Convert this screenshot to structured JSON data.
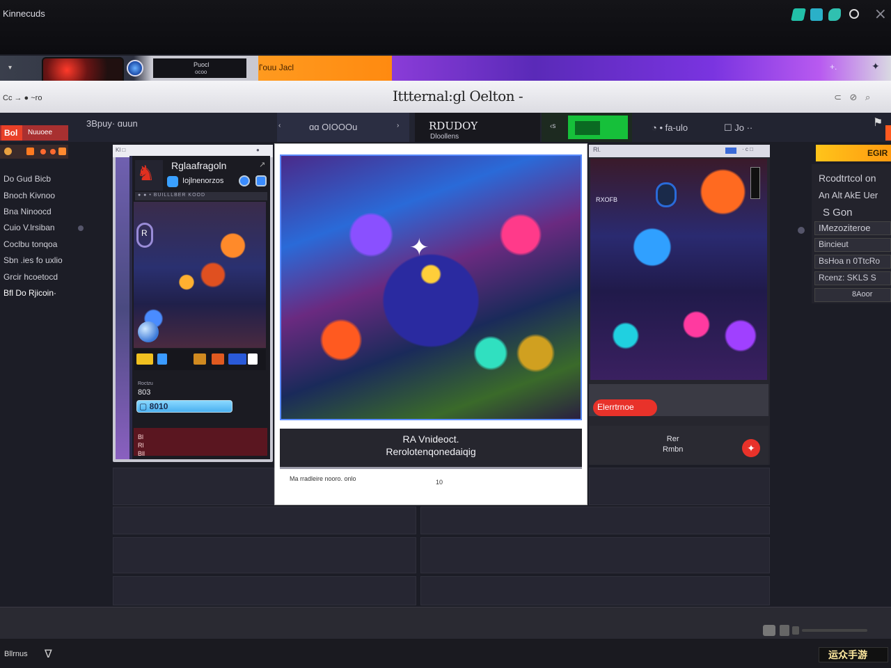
{
  "window": {
    "title": "Kinnecuds",
    "close_glyph": "×"
  },
  "banner": {
    "dark_line1": "Puocl",
    "dark_line2": "ocoo",
    "orange_text": "ſ’ouu Jacl",
    "right_glyph1": "+.",
    "right_glyph2": "✦"
  },
  "toolbar": {
    "left_text": "Cc →  ● ~ro",
    "heading": "Ittternal:gl Oelton -",
    "right_icons": "⊂ ⊘ ⌕"
  },
  "nav": {
    "left_label": "3Bpuy· ɑuun",
    "seg1_label": "ɑɑ OIOOOu",
    "seg2_line1": "RDUDOY",
    "seg2_line2": "Dloollens",
    "seg3_glyph": "‹s",
    "right_label": "◔ • fa-ulo",
    "right_label2": "☐ Jo ··"
  },
  "left_panel": {
    "badge": "Bol",
    "header": "Nuuoее",
    "items": [
      "Do Gud Bicb",
      "Bnoch Kivnoo",
      "Bna Ninoocd",
      "Cuio V.lrsiban",
      "Coclbu tonqoa",
      "Sbn .ies fo uxlio",
      "Grcir hcoetocd",
      "Bfl Do Rjicoin·"
    ]
  },
  "phone": {
    "topbar_left": "Kl □",
    "topbar_right": "●",
    "name": "Rglaafragoln",
    "arrow": "↗",
    "subtitle": "Iojlnenorzos",
    "info_strip": "● ● • BUILLLBER KOOD",
    "ring_glyph": "R",
    "stat_label": "Roctzu",
    "stat_value": "803",
    "progress_text": "▢ 8010",
    "progress_value": 0.72,
    "footer_line1": "Bl",
    "footer_line2": "Rl",
    "footer_line3": "Bll"
  },
  "center": {
    "caption_line1": "RA Vnideoct.",
    "caption_line2": "Rerolotenqonedaiqig",
    "footer_left": "Ma rradlеire nooro. onlo",
    "footer_right": "10"
  },
  "media": {
    "top_left": "Rl.",
    "top_right": "· с □",
    "art_label": "RXOFB",
    "button_label": "Elerrtrnoe",
    "row_line1": "Rer",
    "row_line2": "Rmbn",
    "fab_glyph": "✦"
  },
  "right_sidebar": {
    "header": "EGIR",
    "items": [
      "Rcodtrtcol on",
      "An Alt AkE Uer",
      "S        Gon",
      "IMezoziteroe",
      "Bincieut",
      "BsHoa n 0TtcRo",
      "Rcenz: SKLS S",
      "8Aoor"
    ]
  },
  "status": {
    "left": "Bllrnus",
    "icon": "∇",
    "right": "运众手游"
  },
  "colors": {
    "accent_orange": "#ff9a1f",
    "accent_purple": "#7a34e0",
    "accent_red": "#e8322a",
    "accent_green": "#16c03a",
    "accent_yellow": "#ffc41a"
  }
}
